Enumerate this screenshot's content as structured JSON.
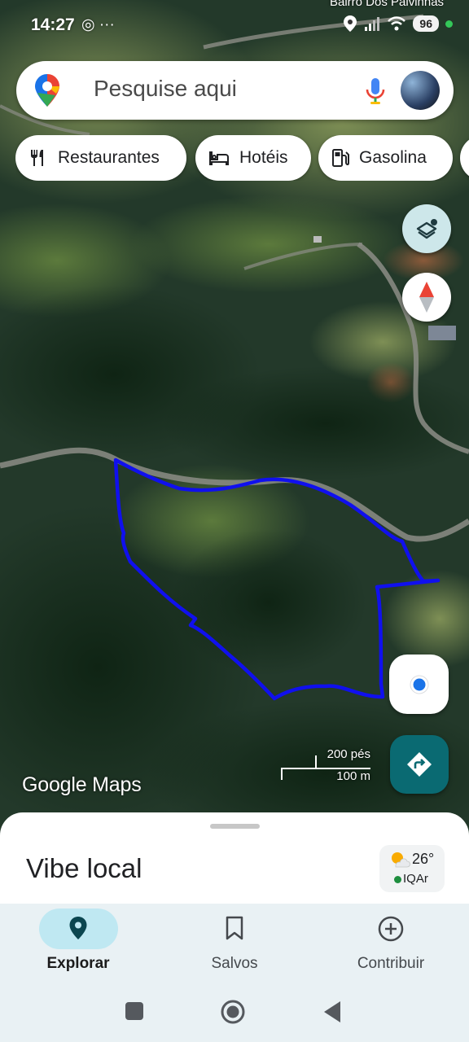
{
  "status_bar": {
    "time": "14:27",
    "extra_icons": "◎ ···",
    "battery": "96"
  },
  "map": {
    "place_label": "Bairro Dos Palvinhas",
    "logo_brand": "Google",
    "logo_product": "Maps",
    "scale_imperial": "200 pés",
    "scale_metric": "100 m",
    "boundary_color": "#1010ee"
  },
  "search": {
    "placeholder": "Pesquise aqui"
  },
  "chips": [
    {
      "label": "Restaurantes",
      "icon": "fork-knife-icon"
    },
    {
      "label": "Hotéis",
      "icon": "bed-icon"
    },
    {
      "label": "Gasolina",
      "icon": "gas-pump-icon"
    }
  ],
  "sheet": {
    "title": "Vibe local",
    "temperature": "26°",
    "air_quality": "IQAr"
  },
  "nav": {
    "items": [
      {
        "label": "Explorar",
        "icon": "explore-pin-icon",
        "active": true
      },
      {
        "label": "Salvos",
        "icon": "bookmark-icon",
        "active": false
      },
      {
        "label": "Contribuir",
        "icon": "add-circle-icon",
        "active": false
      }
    ]
  },
  "colors": {
    "accent_teal": "#0a6a72",
    "nav_active_pill": "#bfe8f2",
    "nav_background": "#e9f1f4"
  }
}
